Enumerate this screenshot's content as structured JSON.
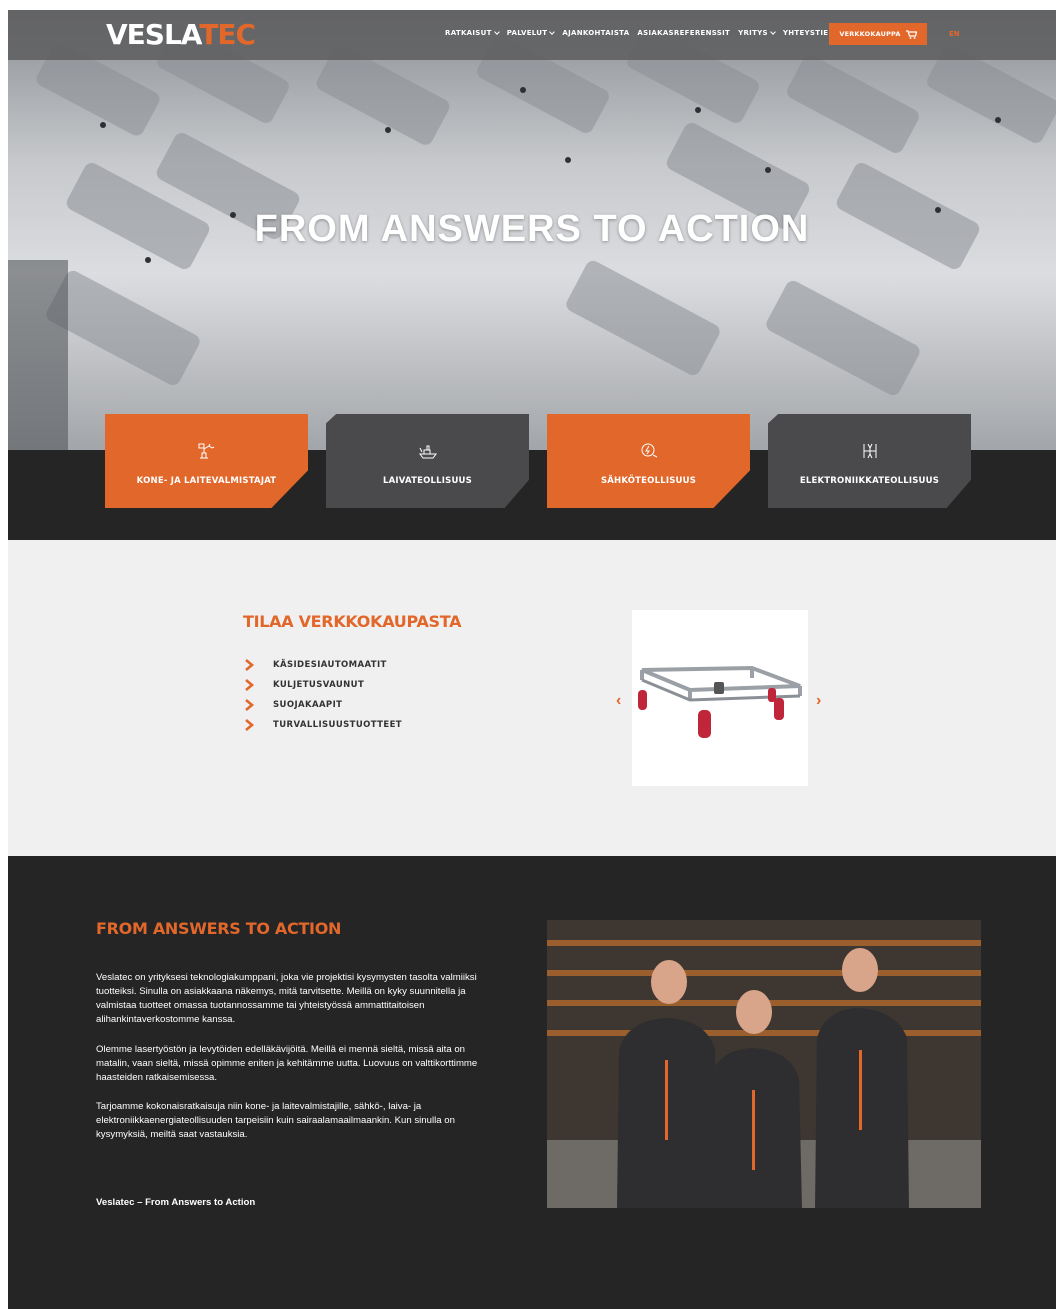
{
  "nav": {
    "logo_left": "VESLA",
    "logo_right": "TEC",
    "items": [
      {
        "label": "RATKAISUT",
        "dropdown": true
      },
      {
        "label": "PALVELUT",
        "dropdown": true
      },
      {
        "label": "AJANKOHTAISTA",
        "dropdown": false
      },
      {
        "label": "ASIAKASREFERENSSIT",
        "dropdown": false
      },
      {
        "label": "YRITYS",
        "dropdown": true
      },
      {
        "label": "YHTEYSTIEDOT",
        "dropdown": false
      }
    ],
    "shop_button": "VERKKOKAUPPA",
    "lang": "EN"
  },
  "hero": {
    "title": "FROM ANSWERS TO ACTION"
  },
  "industries": [
    {
      "label": "KONE- JA LAITEVALMISTAJAT",
      "style": "orange",
      "icon": "robot-arm-icon"
    },
    {
      "label": "LAIVATEOLLISUUS",
      "style": "gray",
      "icon": "ship-icon"
    },
    {
      "label": "SÄHKÖTEOLLISUUS",
      "style": "orange",
      "icon": "electricity-icon"
    },
    {
      "label": "ELEKTRONIIKKATEOLLISUUS",
      "style": "gray",
      "icon": "circuit-icon"
    }
  ],
  "shop": {
    "title": "TILAA VERKKOKAUPASTA",
    "items": [
      "KÄSIDESIAUTOMAATIT",
      "KULJETUSVAUNUT",
      "SUOJAKAAPIT",
      "TURVALLISUUSTUOTTEET"
    ],
    "prev": "‹",
    "next": "›"
  },
  "about": {
    "title": "FROM ANSWERS TO ACTION",
    "paragraphs": [
      "Veslatec on yrityksesi teknologiakumppani, joka vie projektisi kysymysten tasolta valmiiksi tuotteiksi. Sinulla on asiakkaana näkemys, mitä tarvitsette. Meillä on kyky suunnitella ja valmistaa tuotteet omassa tuotannossamme tai yhteistyössä ammattitaitoisen alihankintaverkostomme kanssa.",
      "Olemme lasertyöstön ja levytöiden edelläkävijöitä. Meillä ei mennä sieltä, missä aita on matalin, vaan sieltä, missä opimme eniten ja kehitämme uutta. Luovuus on valttikorttimme haasteiden ratkaisemisessa.",
      "Tarjoamme kokonaisratkaisuja niin kone- ja laitevalmistajille, sähkö-, laiva- ja elektroniikkaenergiateollisuuden tarpeisiin kuin sairaalamaailmaankin. Kun sinulla on kysymyksiä, meiltä saat vastauksia."
    ],
    "tagline": "Veslatec – From Answers to Action"
  },
  "colors": {
    "accent": "#e2672a",
    "dark": "#252525",
    "card_gray": "#4a4a4c",
    "light_bg": "#f0f0f0"
  }
}
